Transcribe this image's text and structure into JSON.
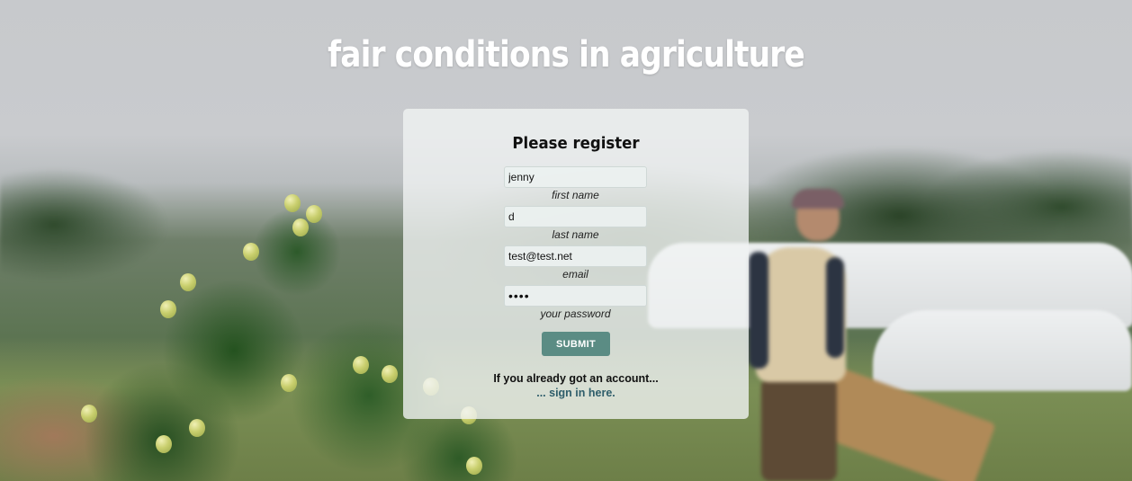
{
  "header": {
    "title": "fair conditions in agriculture"
  },
  "form": {
    "heading": "Please register",
    "fields": [
      {
        "value": "jenny",
        "label": "first name"
      },
      {
        "value": "d",
        "label": "last name"
      },
      {
        "value": "test@test.net",
        "label": "email"
      },
      {
        "value": "••••",
        "label": "your password"
      }
    ],
    "submit_label": "SUBMIT",
    "account_prompt": "If you already got an account...",
    "signin_link": "... sign in here."
  },
  "colors": {
    "accent": "#5b8c84",
    "link": "#2f5e6b",
    "card_background": "#f0f3f2"
  },
  "background": {
    "icon": "farm-photo-background"
  }
}
